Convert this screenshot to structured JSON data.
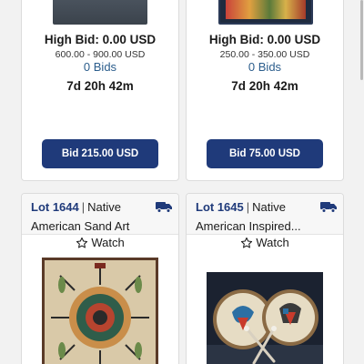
{
  "cards": [
    {
      "high_bid": "High Bid: 0.00 USD",
      "estimate": "600.00 - 900.00 USD",
      "bids": "0 Bids",
      "time_left": "7d 20h 42m",
      "bid_button": "Bid 215.00 USD"
    },
    {
      "high_bid": "High Bid: 0.00 USD",
      "estimate": "250.00 - 350.00 USD",
      "bids": "0 Bids",
      "time_left": "7d 20h 42m",
      "bid_button": "Bid 75.00 USD"
    },
    {
      "lot": "Lot 1644",
      "category": "Native",
      "title": "American Sand Art",
      "watch": "Watch"
    },
    {
      "lot": "Lot 1645",
      "category": "Native",
      "title": "American Inspired...",
      "watch": "Watch"
    }
  ],
  "colors": {
    "accent": "#1f3a7a",
    "bids_link": "#2b5d8c"
  },
  "icons": [
    "truck-icon",
    "star-outline-icon"
  ]
}
